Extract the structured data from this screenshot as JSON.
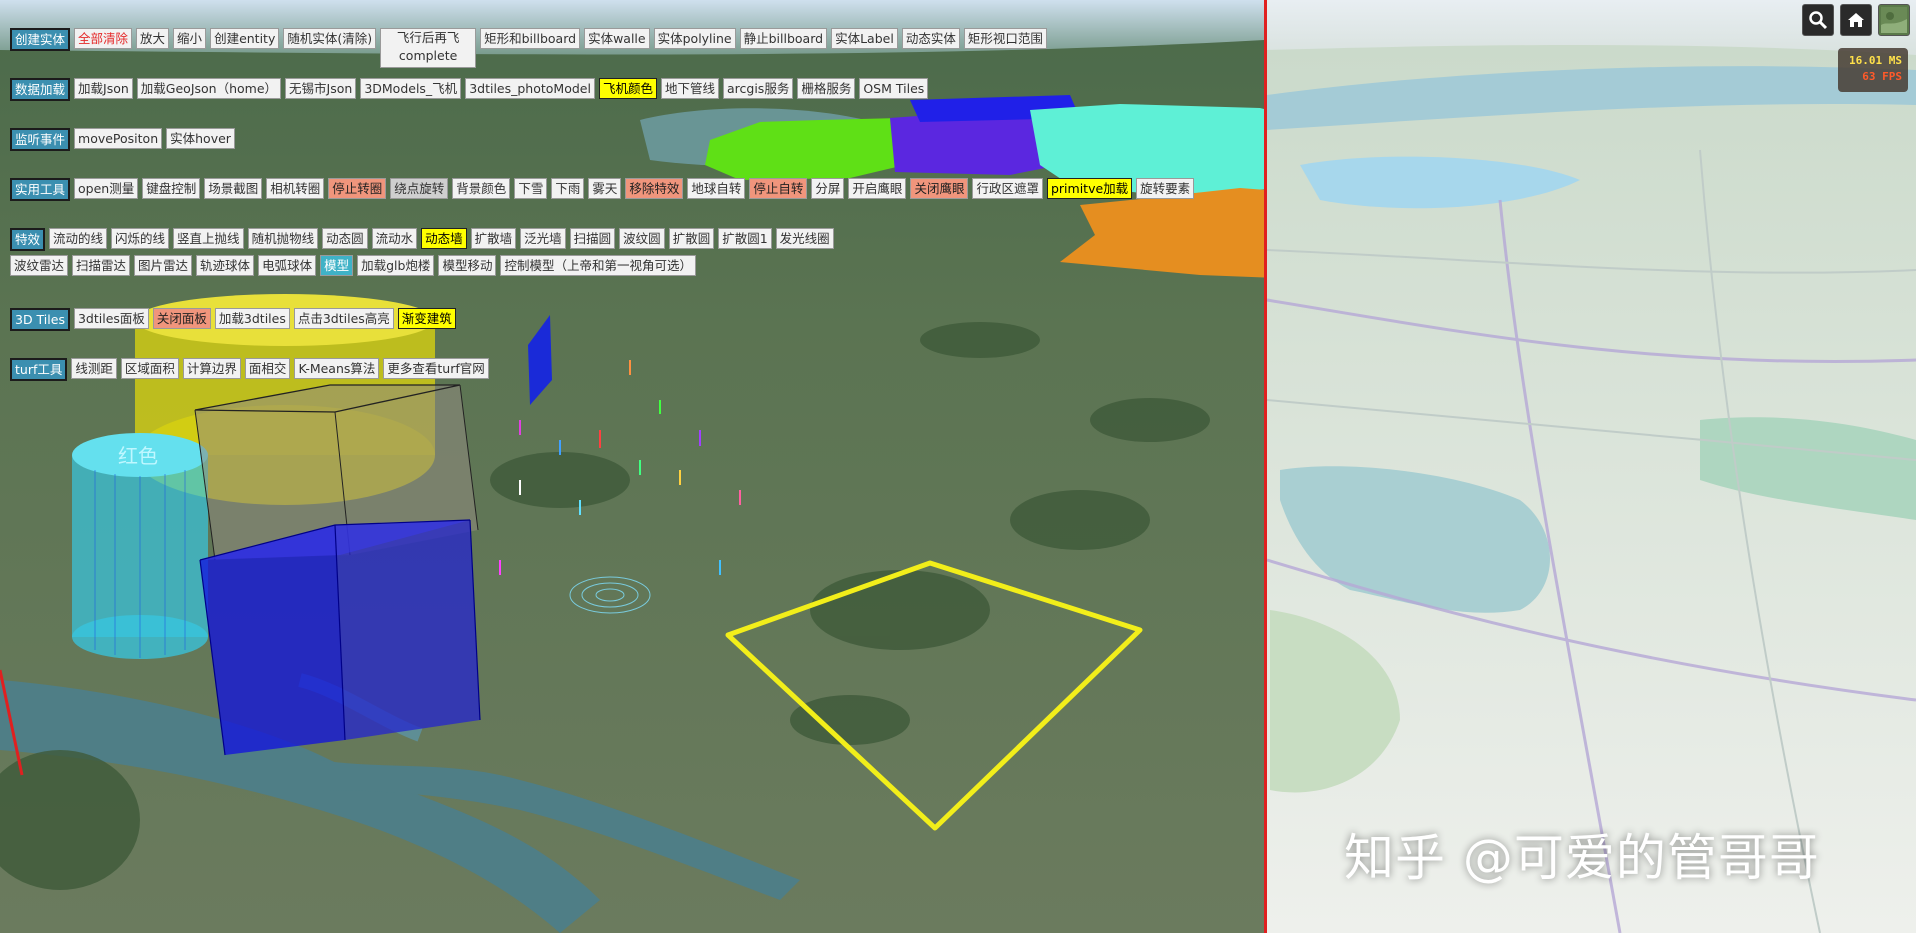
{
  "toolbar": {
    "rows": [
      {
        "label": "创建实体",
        "buttons": [
          "全部清除",
          "放大",
          "缩小",
          "创建entity",
          "随机实体(清除)",
          "飞行后再飞 complete",
          "矩形和billboard",
          "实体walle",
          "实体polyline",
          "静止billboard",
          "实体Label",
          "动态实体",
          "矩形视口范围"
        ]
      },
      {
        "label": "数据加载",
        "buttons": [
          "加载Json",
          "加载GeoJson（home）",
          "无锡市Json",
          "3DModels_飞机",
          "3dtiles_photoModel",
          "飞机颜色",
          "地下管线",
          "arcgis服务",
          "栅格服务",
          "OSM Tiles"
        ]
      },
      {
        "label": "监听事件",
        "buttons": [
          "movePositon",
          "实体hover"
        ]
      },
      {
        "label": "实用工具",
        "buttons": [
          "open测量",
          "键盘控制",
          "场景截图",
          "相机转圈",
          "停止转圈",
          "绕点旋转",
          "背景颜色",
          "下雪",
          "下雨",
          "雾天",
          "移除特效",
          "地球自转",
          "停止自转",
          "分屏",
          "开启鹰眼",
          "关闭鹰眼",
          "行政区遮罩",
          "primitve加载",
          "旋转要素"
        ]
      },
      {
        "label": "特效",
        "buttons": [
          "流动的线",
          "闪烁的线",
          "竖直上抛线",
          "随机抛物线",
          "动态圆",
          "流动水",
          "动态墙",
          "扩散墙",
          "泛光墙",
          "扫描圆",
          "波纹圆",
          "扩散圆",
          "扩散圆1",
          "发光线圈",
          "波纹雷达",
          "扫描雷达",
          "图片雷达",
          "轨迹球体",
          "电弧球体",
          "模型",
          "加载glb炮楼",
          "模型移动",
          "控制模型（上帝和第一视角可选）"
        ]
      },
      {
        "label": "3D Tiles",
        "buttons": [
          "3dtiles面板",
          "关闭面板",
          "加载3dtiles",
          "点击3dtiles高亮",
          "渐变建筑"
        ]
      },
      {
        "label": "turf工具",
        "buttons": [
          "线测距",
          "区域面积",
          "计算边界",
          "面相交",
          "K-Means算法",
          "更多查看turf官网"
        ]
      }
    ]
  },
  "scene": {
    "cylinder_label": "红色",
    "colors": {
      "split_line": "#e02020",
      "highlight_button": "#ffff00",
      "active_button": "#f0957c",
      "row_label": "#3b8fb0"
    }
  },
  "widgets": {
    "search_icon": "search-icon",
    "home_icon": "home-icon",
    "basemap_icon": "basemap-picker-icon"
  },
  "performance": {
    "ms": "16.01 MS",
    "fps": "63 FPS"
  },
  "watermark": "知乎 @可爱的管哥哥"
}
